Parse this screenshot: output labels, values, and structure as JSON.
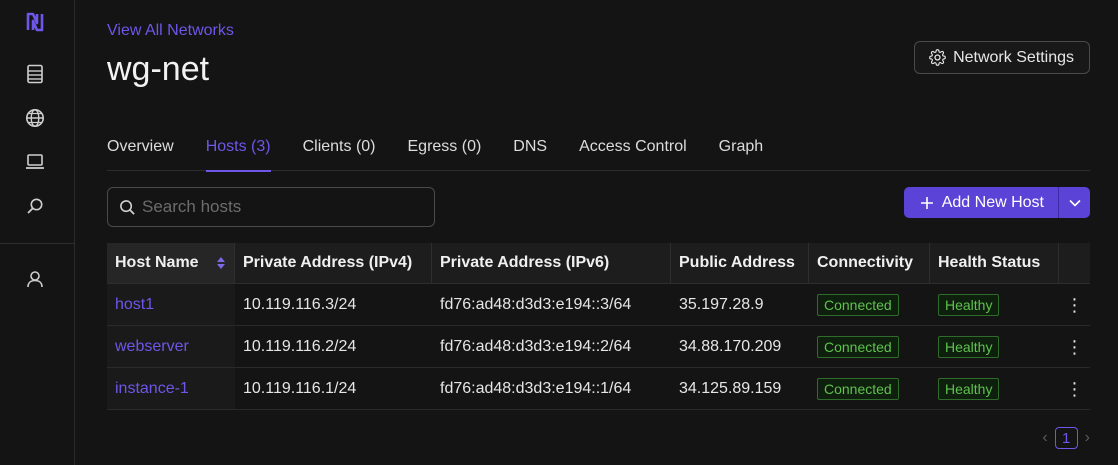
{
  "sidebar": {
    "icons": [
      "logo-icon",
      "hosts-icon",
      "globe-icon",
      "laptop-icon",
      "search-icon",
      "user-icon"
    ]
  },
  "breadcrumb": "View All Networks",
  "title": "wg-net",
  "settings_label": "Network Settings",
  "tabs": [
    "Overview",
    "Hosts (3)",
    "Clients (0)",
    "Egress (0)",
    "DNS",
    "Access Control",
    "Graph"
  ],
  "active_tab": "Hosts (3)",
  "search": {
    "placeholder": "Search hosts",
    "value": ""
  },
  "add_button_label": "Add New Host",
  "table": {
    "headers": [
      "Host Name",
      "Private Address (IPv4)",
      "Private Address (IPv6)",
      "Public Address",
      "Connectivity",
      "Health Status"
    ],
    "rows": [
      {
        "name": "host1",
        "ipv4": "10.119.116.3/24",
        "ipv6": "fd76:ad48:d3d3:e194::3/64",
        "public": "35.197.28.9",
        "connectivity": "Connected",
        "health": "Healthy"
      },
      {
        "name": "webserver",
        "ipv4": "10.119.116.2/24",
        "ipv6": "fd76:ad48:d3d3:e194::2/64",
        "public": "34.88.170.209",
        "connectivity": "Connected",
        "health": "Healthy"
      },
      {
        "name": "instance-1",
        "ipv4": "10.119.116.1/24",
        "ipv6": "fd76:ad48:d3d3:e194::1/64",
        "public": "34.125.89.159",
        "connectivity": "Connected",
        "health": "Healthy"
      }
    ]
  },
  "pagination": {
    "current_page": "1"
  },
  "colors": {
    "accent": "#6e56e8",
    "primary_button": "#5a43d6",
    "success": "#5fc24f",
    "background": "#141414"
  }
}
